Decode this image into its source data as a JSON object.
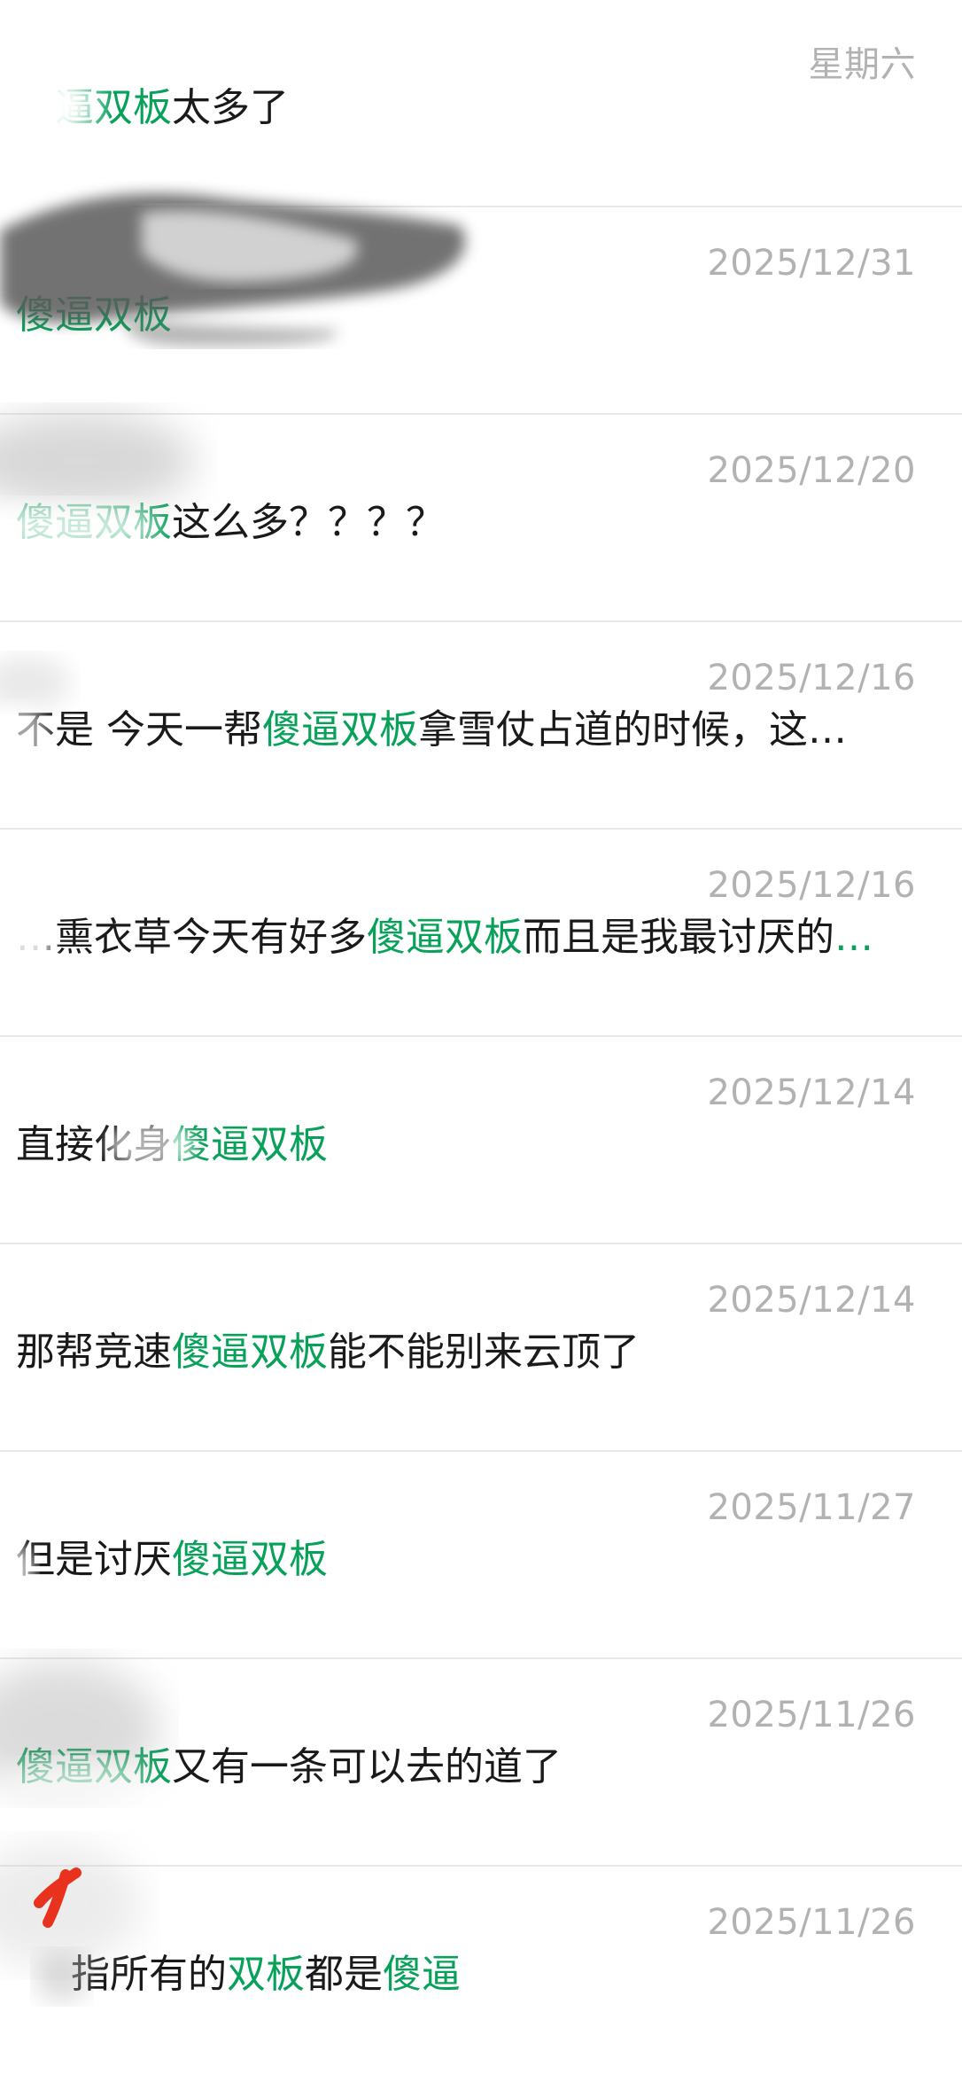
{
  "search_results": {
    "keyword_color": "#07a15a",
    "rows": [
      {
        "date": "星期六",
        "pre": "",
        "kw": "逼双板",
        "post": "太多了",
        "tail": ""
      },
      {
        "date": "2025/12/31",
        "pre": "",
        "kw": "傻逼双板",
        "post": "",
        "tail": ""
      },
      {
        "date": "2025/12/20",
        "pre": "",
        "kw": "傻逼双板",
        "post": "这么多？？？？",
        "tail": ""
      },
      {
        "date": "2025/12/16",
        "pre": "不是 今天一帮",
        "kw": "傻逼双板",
        "post": "拿雪仗占道的时候，这…",
        "tail": ""
      },
      {
        "date": "2025/12/16",
        "pre": "…熏衣草今天有好多",
        "kw": "傻逼双板",
        "post": "而且是我最讨厌的",
        "tail": "…"
      },
      {
        "date": "2025/12/14",
        "pre": "直接化身",
        "kw": "傻逼双板",
        "post": "",
        "tail": ""
      },
      {
        "date": "2025/12/14",
        "pre": "那帮竞速",
        "kw": "傻逼双板",
        "post": "能不能别来云顶了",
        "tail": ""
      },
      {
        "date": "2025/11/27",
        "pre": "但是讨厌",
        "kw": "傻逼双板",
        "post": "",
        "tail": ""
      },
      {
        "date": "2025/11/26",
        "pre": "",
        "kw": "傻逼双板",
        "post": "又有一条可以去的道了",
        "tail": ""
      },
      {
        "date": "2025/11/26",
        "pre": "指所有的",
        "kw": "双板",
        "post": "都是",
        "tail": "傻逼"
      }
    ]
  }
}
